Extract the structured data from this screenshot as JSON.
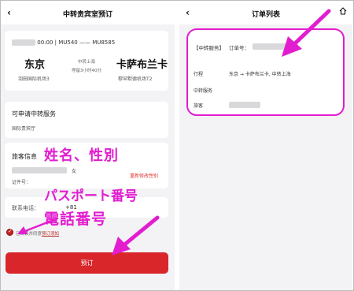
{
  "left": {
    "header": {
      "back": "‹",
      "title": "中转贵宾室预订"
    },
    "flight": {
      "number_text": "00:00 | MU540 —— MU8585",
      "origin_city": "东京",
      "origin_airport": "羽田国际机场3",
      "via_label": "中转上海",
      "layover": "停留3小时40分",
      "dest_city": "卡萨布兰卡",
      "dest_airport": "穆罕默德机场T2"
    },
    "services": {
      "title": "可申请中转服务",
      "item": "国际贵宾厅"
    },
    "passenger": {
      "title": "旅客信息",
      "gender": "女",
      "id_label": "证件号：",
      "edit": "重新修改性别"
    },
    "contact": {
      "label": "联系电话：",
      "prefix": "+81"
    },
    "agreement": {
      "text": "已阅读并同意",
      "link": "预订须知"
    },
    "book_button": "预订"
  },
  "right": {
    "header": {
      "back": "‹",
      "title": "订单列表"
    },
    "order": {
      "service_label": "【中转服务】",
      "order_no_label": "订单号：",
      "trip_label": "行程",
      "trip_value": "东京 → 卡萨布兰卡, 中转上海",
      "service_row_label": "中转服务",
      "passenger_label": "旅客"
    }
  },
  "annotations": {
    "name_gender": "姓名、性別",
    "passport": "パスポート番号",
    "phone": "電話番号",
    "color": "#e21dd0"
  }
}
